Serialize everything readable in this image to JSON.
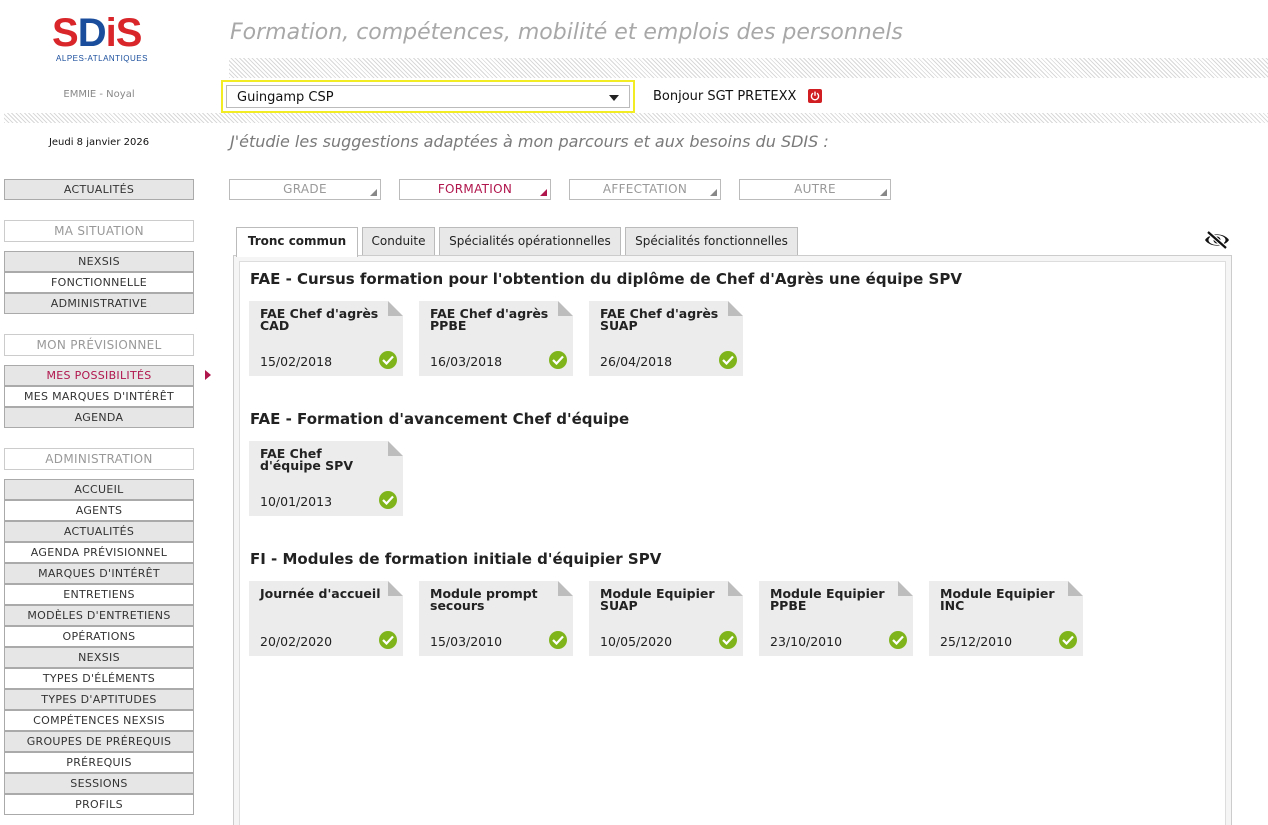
{
  "brand": {
    "logo_text_s": "S",
    "logo_text_d": "D",
    "logo_text_is": "iS",
    "logo_sub": "ALPES-ATLANTIQUES"
  },
  "header": {
    "tagline": "Formation, compétences, mobilité et emplois des personnels",
    "user_location": "EMMIE - Noyal",
    "site_selected": "Guingamp CSP",
    "greeting": "Bonjour SGT PRETEXX",
    "date": "Jeudi 8 janvier 2026",
    "subtitle": "J'étudie les suggestions adaptées à mon parcours et aux besoins du SDIS :"
  },
  "sidebar": {
    "news": "ACTUALITÉS",
    "situation_title": "MA SITUATION",
    "situation_items": [
      "NEXSIS",
      "FONCTIONNELLE",
      "ADMINISTRATIVE"
    ],
    "forecast_title": "MON PRÉVISIONNEL",
    "forecast_items": [
      "MES POSSIBILITÉS",
      "MES MARQUES D'INTÉRÊT",
      "AGENDA"
    ],
    "admin_title": "ADMINISTRATION",
    "admin_items": [
      "ACCUEIL",
      "AGENTS",
      "ACTUALITÉS",
      "AGENDA PRÉVISIONNEL",
      "MARQUES D'INTÉRÊT",
      "ENTRETIENS",
      "MODÈLES D'ENTRETIENS",
      "OPÉRATIONS",
      "NEXSIS",
      "TYPES D'ÉLÉMENTS",
      "TYPES D'APTITUDES",
      "COMPÉTENCES NEXSIS",
      "GROUPES DE PRÉREQUIS",
      "PRÉREQUIS",
      "SESSIONS",
      "PROFILS"
    ]
  },
  "categories": [
    "GRADE",
    "FORMATION",
    "AFFECTATION",
    "AUTRE"
  ],
  "tabs": [
    "Tronc commun",
    "Conduite",
    "Spécialités opérationnelles",
    "Spécialités fonctionnelles"
  ],
  "groups": [
    {
      "title": "FAE - Cursus formation pour l'obtention du diplôme de Chef d'Agrès une équipe SPV",
      "cards": [
        {
          "title": "FAE Chef d'agrès CAD",
          "date": "15/02/2018"
        },
        {
          "title": "FAE Chef d'agrès PPBE",
          "date": "16/03/2018"
        },
        {
          "title": "FAE Chef d'agrès SUAP",
          "date": "26/04/2018"
        }
      ]
    },
    {
      "title": "FAE - Formation d'avancement Chef d'équipe",
      "cards": [
        {
          "title": "FAE Chef d'équipe SPV",
          "date": "10/01/2013"
        }
      ]
    },
    {
      "title": "FI - Modules de formation initiale d'équipier SPV",
      "cards": [
        {
          "title": "Journée d'accueil",
          "date": "20/02/2020"
        },
        {
          "title": "Module prompt secours",
          "date": "15/03/2010"
        },
        {
          "title": "Module Equipier SUAP",
          "date": "10/05/2020"
        },
        {
          "title": "Module Equipier PPBE",
          "date": "23/10/2010"
        },
        {
          "title": "Module Equipier INC",
          "date": "25/12/2010"
        }
      ]
    }
  ],
  "colors": {
    "accent": "#b0154c",
    "check": "#7fb51b",
    "select_highlight": "#f2ec25",
    "power": "#d01e23"
  },
  "icons": {
    "logout": "power-icon",
    "visibility": "eye-slash-icon",
    "done": "check-circle-icon"
  }
}
